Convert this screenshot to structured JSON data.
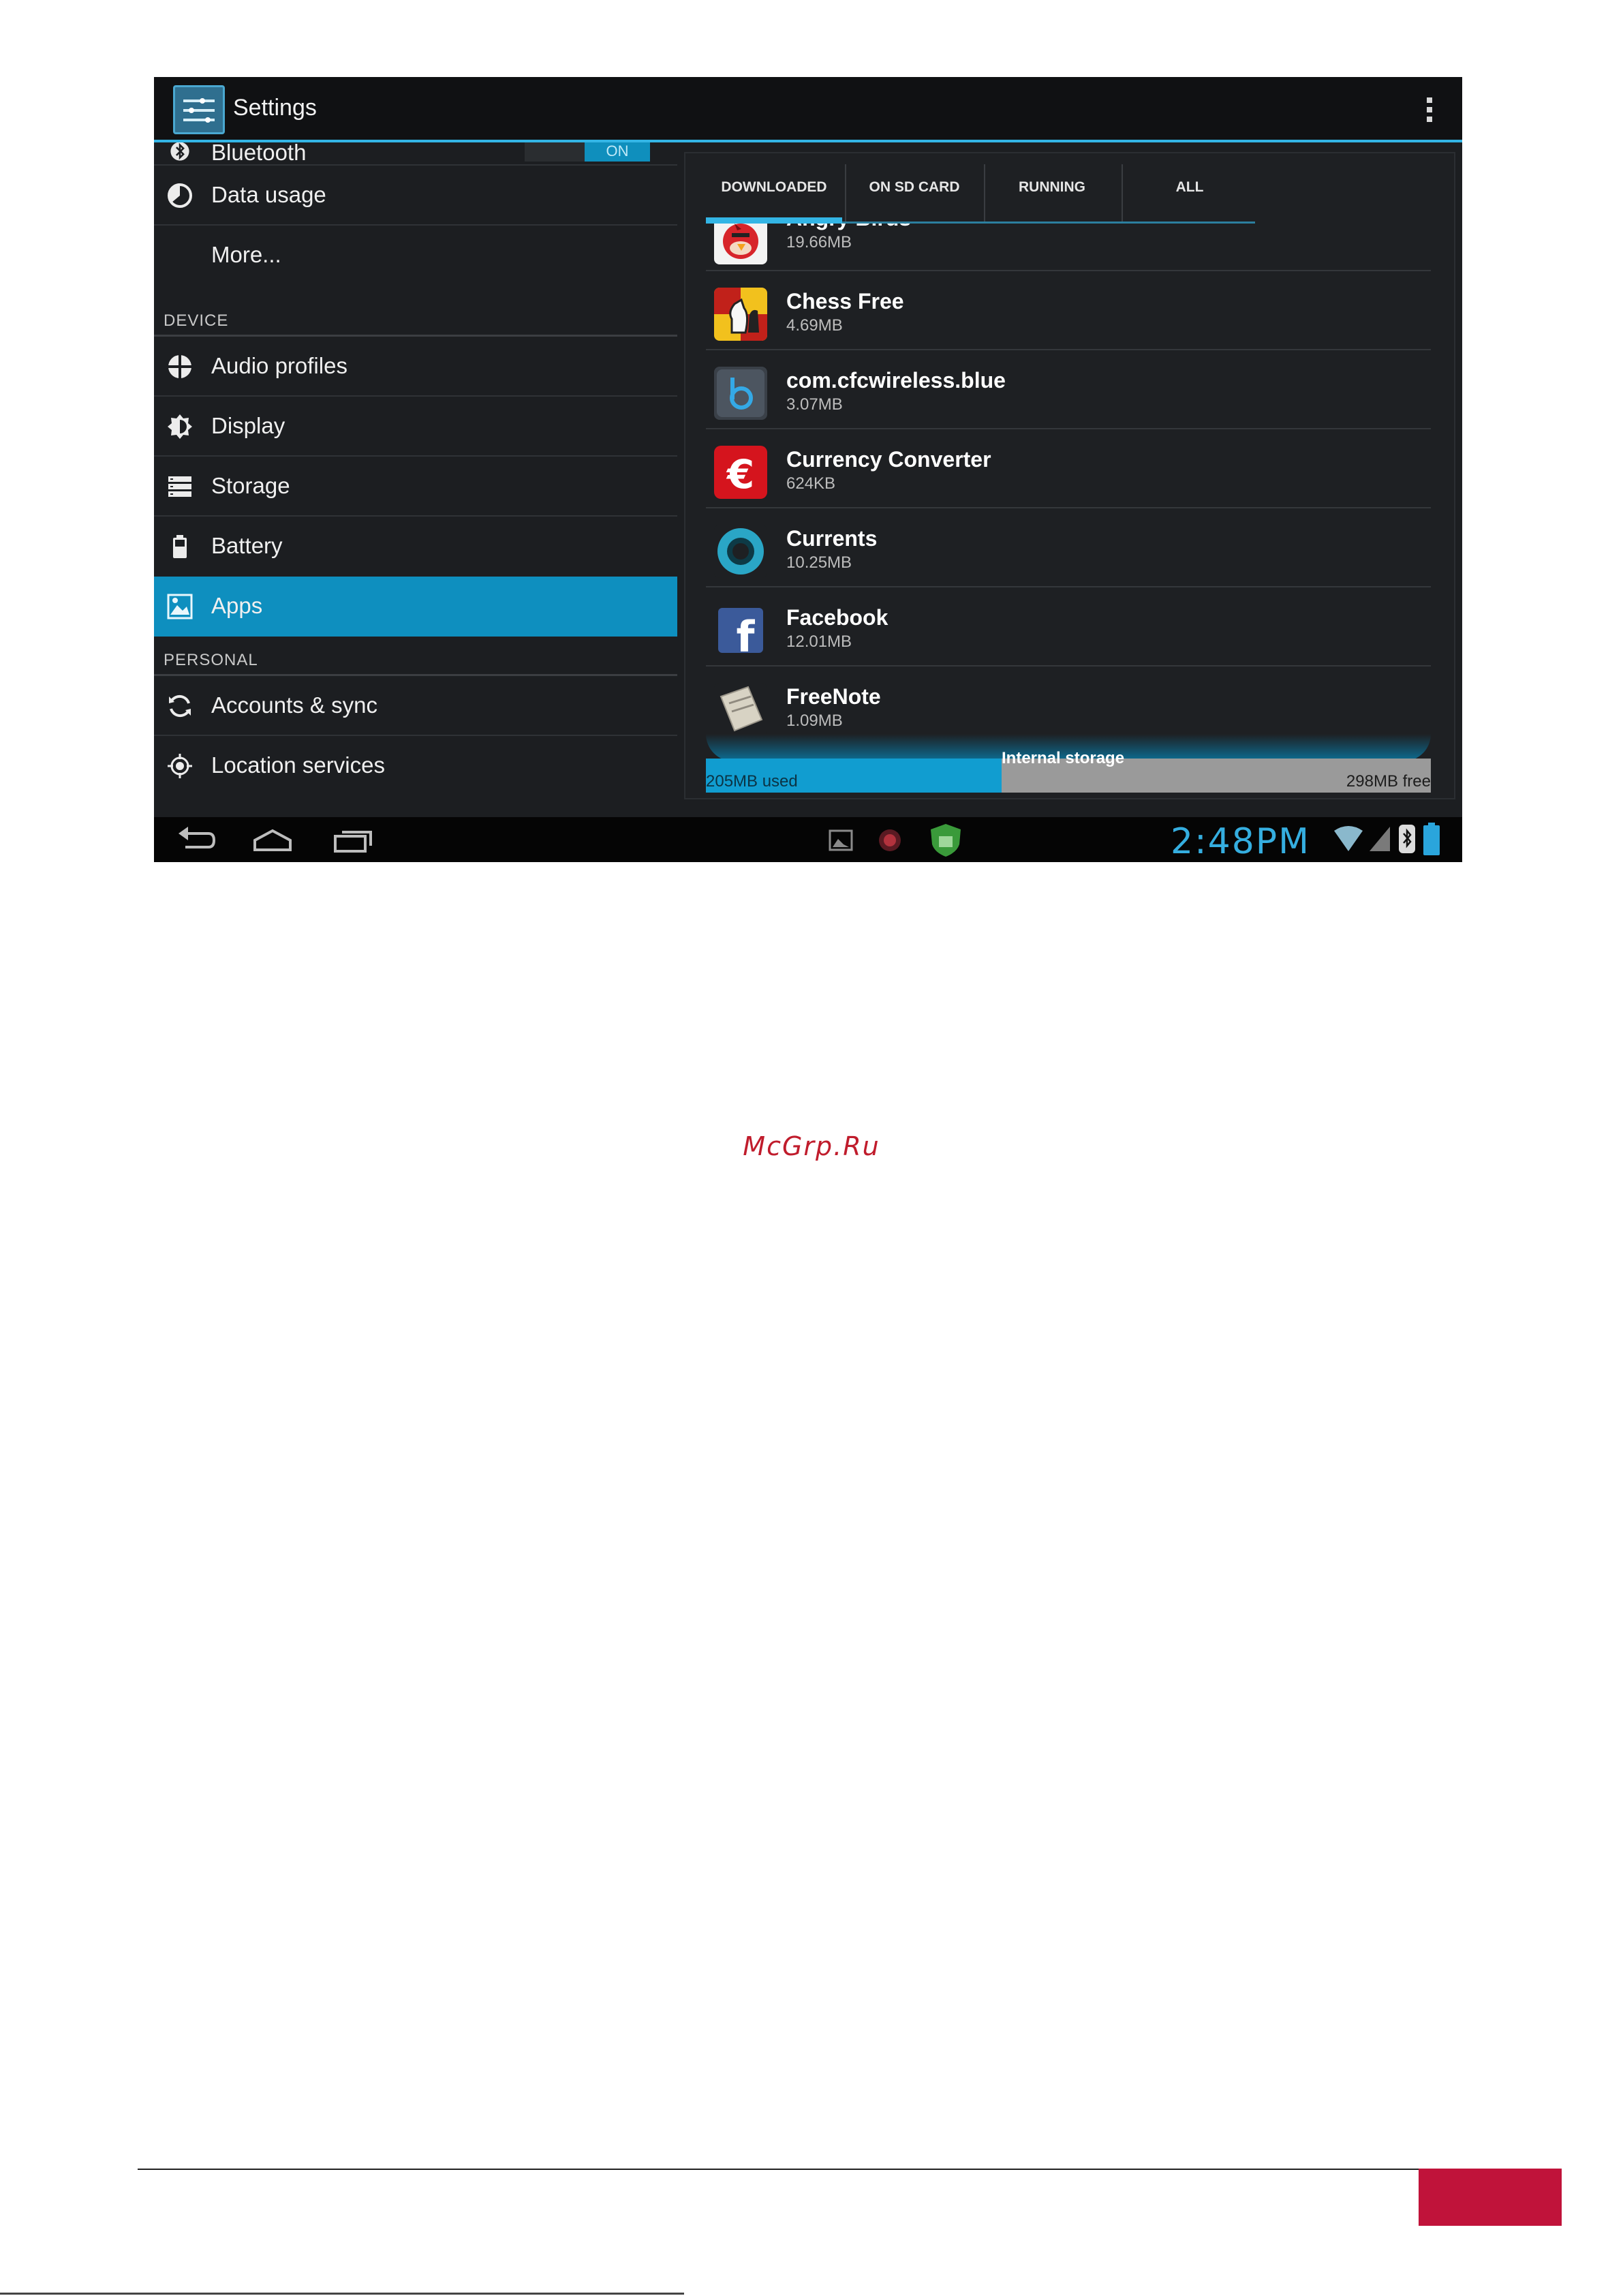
{
  "app": {
    "title": "Settings"
  },
  "sidebar": {
    "bluetooth": {
      "label": "Bluetooth",
      "toggle": "ON"
    },
    "items_wireless": [
      {
        "label": "Data usage"
      },
      {
        "label": "More..."
      }
    ],
    "section_device": "DEVICE",
    "items_device": [
      {
        "label": "Audio profiles"
      },
      {
        "label": "Display"
      },
      {
        "label": "Storage"
      },
      {
        "label": "Battery"
      },
      {
        "label": "Apps"
      }
    ],
    "section_personal": "PERSONAL",
    "items_personal": [
      {
        "label": "Accounts & sync"
      },
      {
        "label": "Location services"
      }
    ]
  },
  "tabs": [
    {
      "label": "DOWNLOADED"
    },
    {
      "label": "ON SD CARD"
    },
    {
      "label": "RUNNING"
    },
    {
      "label": "ALL"
    }
  ],
  "apps": [
    {
      "name": "Angry Birds",
      "size": "19.66MB"
    },
    {
      "name": "Chess Free",
      "size": "4.69MB"
    },
    {
      "name": "com.cfcwireless.blue",
      "size": "3.07MB"
    },
    {
      "name": "Currency Converter",
      "size": "624KB"
    },
    {
      "name": "Currents",
      "size": "10.25MB"
    },
    {
      "name": "Facebook",
      "size": "12.01MB"
    },
    {
      "name": "FreeNote",
      "size": "1.09MB"
    }
  ],
  "storage": {
    "label": "Internal storage",
    "used": "205MB used",
    "free": "298MB free",
    "used_fraction": 0.408
  },
  "status": {
    "time": "2:48PM"
  },
  "colors": {
    "accent": "#33b5e5",
    "selected": "#0e8fbf",
    "brand": "#c0133a"
  },
  "watermark": "McGrp.Ru"
}
